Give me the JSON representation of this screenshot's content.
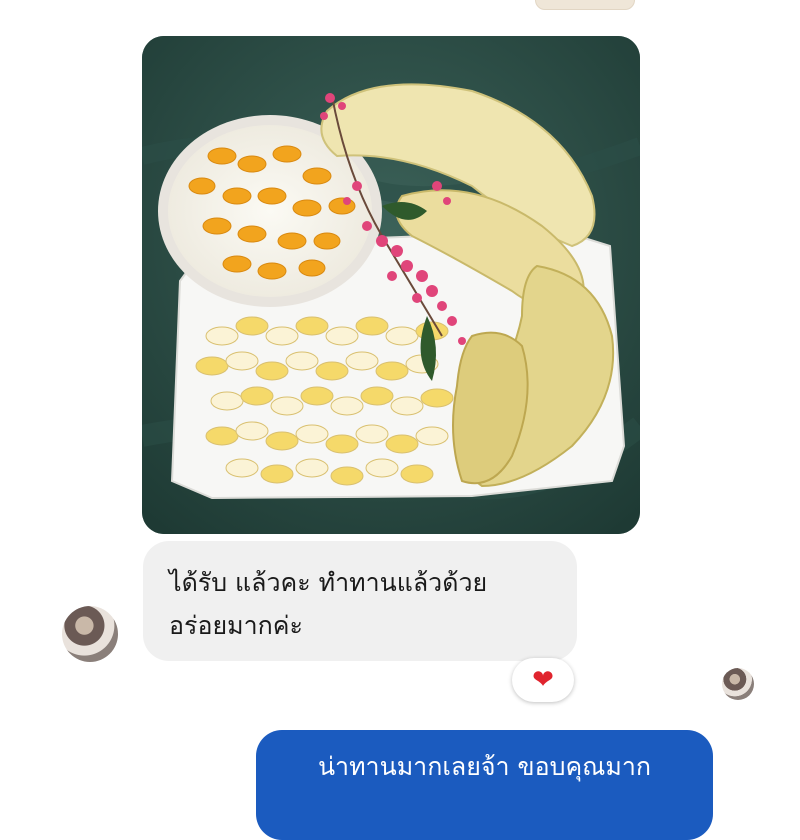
{
  "chat": {
    "photo_icon": "shared-photo",
    "incoming": {
      "line1": "ได้รับ แล้วคะ ทำทานแล้วด้วย",
      "line2": "อร่อยมากค่ะ"
    },
    "reaction": {
      "emoji": "❤",
      "icon": "heart-icon",
      "color": "#e0242e"
    },
    "outgoing": {
      "line1": "น่าทานมากเลยจ้า ขอบคุณมาก"
    },
    "colors": {
      "outgoing_bubble": "#1b5bbf",
      "incoming_bubble": "#f0f0f0"
    }
  }
}
